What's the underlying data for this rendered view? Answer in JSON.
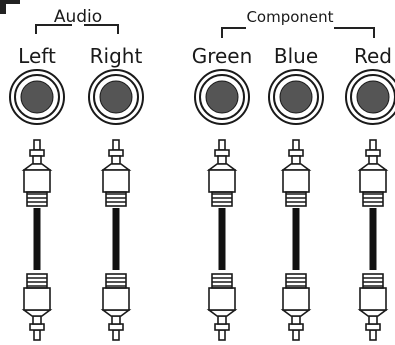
{
  "groups": {
    "audio": "Audio",
    "component": "Component"
  },
  "jacks": [
    {
      "id": "left",
      "label": "Left"
    },
    {
      "id": "right",
      "label": "Right"
    },
    {
      "id": "green",
      "label": "Green"
    },
    {
      "id": "blue",
      "label": "Blue"
    },
    {
      "id": "red",
      "label": "Red"
    }
  ]
}
